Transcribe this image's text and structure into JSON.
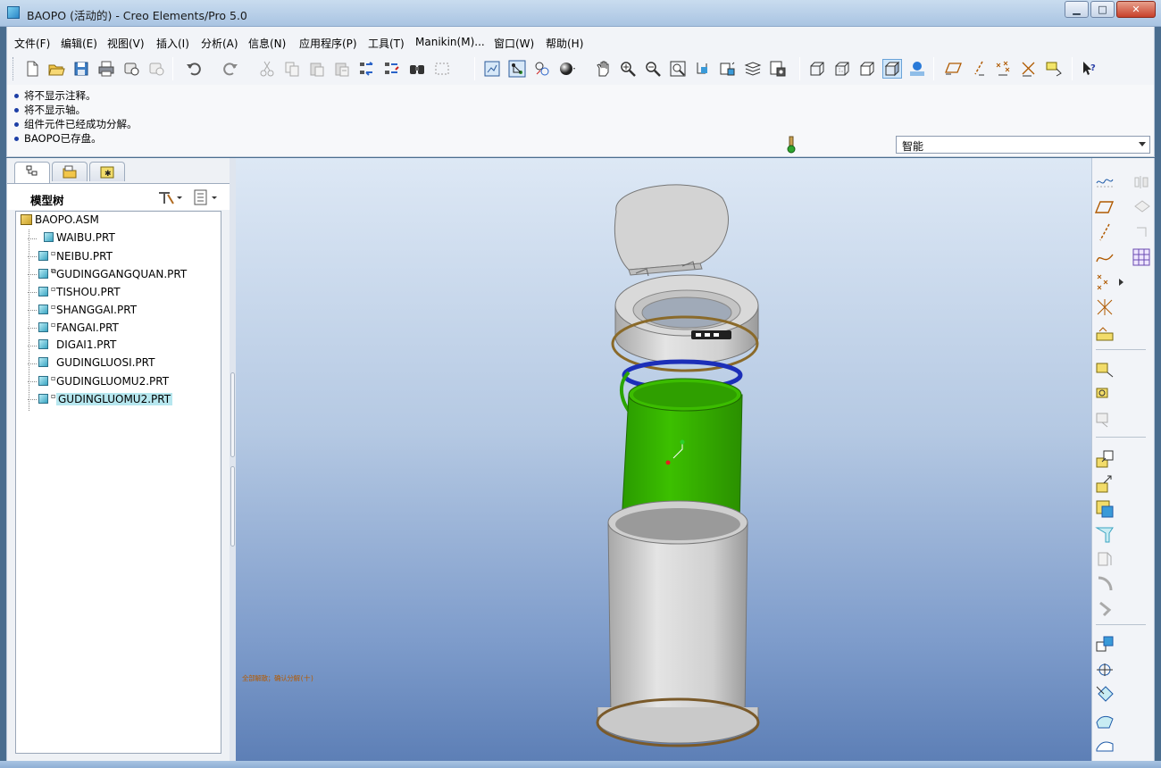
{
  "window": {
    "title": "BAOPO (活动的) - Creo Elements/Pro 5.0",
    "minimize_label": "▁",
    "maximize_label": "□",
    "close_label": "✕"
  },
  "menu": [
    "文件(F)",
    "编辑(E)",
    "视图(V)",
    "插入(I)",
    "分析(A)",
    "信息(N)",
    "应用程序(P)",
    "工具(T)",
    "Manikin(M)...",
    "窗口(W)",
    "帮助(H)"
  ],
  "toolbar_icons": [
    "new-file-icon",
    "open-folder-icon",
    "save-icon",
    "print-icon",
    "send-mail-icon",
    "mail-disabled-icon",
    "undo-icon",
    "redo-icon",
    "cut-icon",
    "copy-icon",
    "paste-icon",
    "paste-special-icon",
    "regenerate-icon",
    "regenerate-manager-icon",
    "find-icon",
    "select-box-icon",
    "display-datum-icon",
    "spin-center-icon",
    "layers-icon",
    "appearance-icon",
    "pan-icon",
    "zoom-in-icon",
    "zoom-out-icon",
    "refit-icon",
    "reorient-icon",
    "saved-views-icon",
    "layer-tree-icon",
    "view-manager-icon",
    "wireframe-icon",
    "hidden-line-icon",
    "no-hidden-icon",
    "shading-icon",
    "enhanced-realism-icon",
    "datum-planes-icon",
    "datum-axes-icon",
    "datum-points-icon",
    "coordinate-systems-icon",
    "annotations-icon",
    "context-help-icon"
  ],
  "messages": [
    "将不显示注释。",
    "将不显示轴。",
    "组件元件已经成功分解。",
    "BAOPO已存盘。"
  ],
  "filter": {
    "value": "智能"
  },
  "model_tree": {
    "title": "模型树",
    "root": "BAOPO.ASM",
    "items": [
      {
        "label": "WAIBU.PRT",
        "mark": ""
      },
      {
        "label": "NEIBU.PRT",
        "mark": "▫"
      },
      {
        "label": "GUDINGGANGQUAN.PRT",
        "mark": "⧉"
      },
      {
        "label": "TISHOU.PRT",
        "mark": "▫"
      },
      {
        "label": "SHANGGAI.PRT",
        "mark": "▫"
      },
      {
        "label": "FANGAI.PRT",
        "mark": "▫"
      },
      {
        "label": "DIGAI1.PRT",
        "mark": ""
      },
      {
        "label": "GUDINGLUOSI.PRT",
        "mark": ""
      },
      {
        "label": "GUDINGLUOMU2.PRT",
        "mark": "▫"
      },
      {
        "label": "GUDINGLUOMU2.PRT",
        "mark": "▫",
        "selected": true
      }
    ]
  },
  "graphics": {
    "status_text": "全部解散；确认分解(十)",
    "colors": {
      "grey_part": "#c9c9c9",
      "green_part": "#33b300",
      "blue_ring": "#1c2fb8",
      "brown_edge": "#7a5a2a"
    }
  },
  "right_toolbar_icons": [
    "sketch-tool-icon",
    "datum-plane-icon",
    "datum-axis-icon",
    "datum-curve-icon",
    "datum-point-icon",
    "csys-icon",
    "analysis-feature-icon",
    "extrude-icon",
    "revolve-icon",
    "sweep-icon",
    "hole-icon",
    "shell-icon",
    "rib-icon",
    "draft-icon",
    "round-icon",
    "chamfer-icon",
    "pattern-icon",
    "mirror-icon",
    "trim-icon",
    "merge-icon",
    "extend-icon",
    "mirror-disabled-icon",
    "copy-disabled-icon",
    "offset-disabled-icon",
    "table-icon"
  ]
}
